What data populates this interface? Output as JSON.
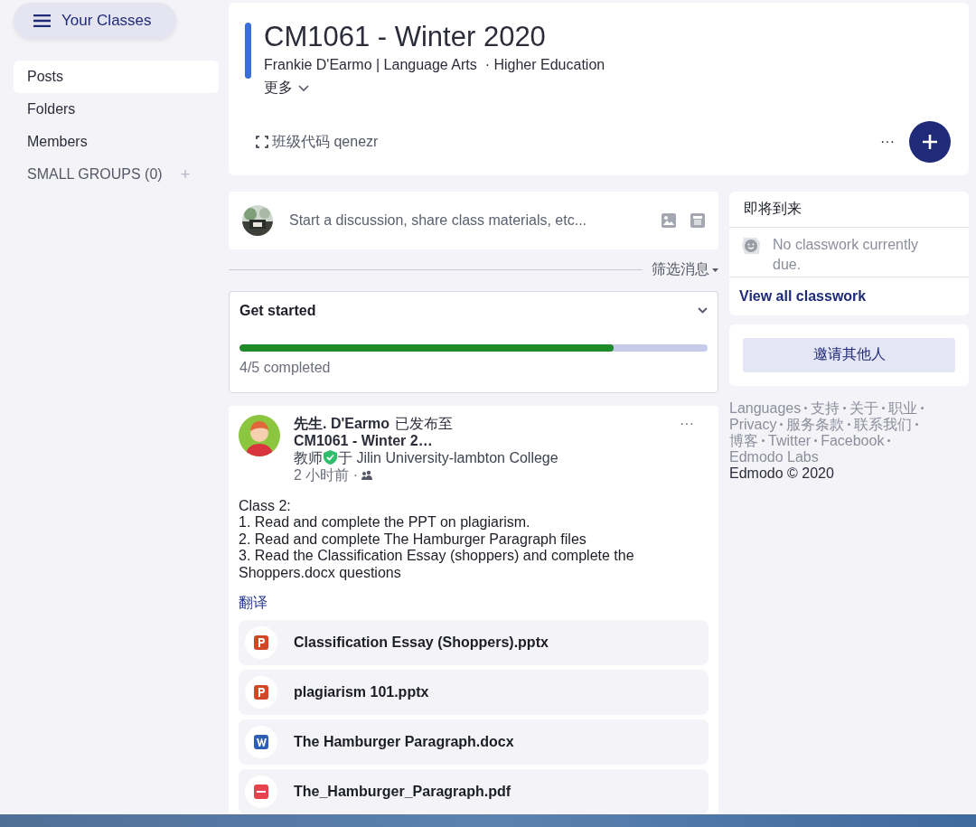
{
  "sidebar": {
    "classes_button": "Your Classes",
    "items": [
      {
        "label": "Posts",
        "selected": true
      },
      {
        "label": "Folders",
        "selected": false
      },
      {
        "label": "Members",
        "selected": false
      }
    ],
    "small_groups": "SMALL GROUPS (0)",
    "add_icon": "+"
  },
  "header": {
    "title": "CM1061 - Winter 2020",
    "subtitle": "Frankie D'Earmo | Language Arts  · Higher Education",
    "more": "更多",
    "class_code": "班级代码 qenezr",
    "ellipsis": "···"
  },
  "composer": {
    "placeholder": "Start a discussion, share class materials, etc..."
  },
  "filter": "筛选消息",
  "get_started": {
    "title": "Get started",
    "level": 0.8,
    "status": "4/5 completed"
  },
  "post": {
    "author": "先生. D'Earmo",
    "posted_to": "已发布至",
    "class": "CM1061 - Winter 2…",
    "role": "教师",
    "school": "于 Jilin University-lambton College",
    "time": "2 小时前 ·",
    "ellipsis": "···",
    "body": [
      "Class 2:",
      "1. Read and complete the PPT on plagiarism.",
      "2. Read and complete The Hamburger Paragraph files",
      "3. Read the Classification Essay (shoppers) and complete the Shoppers.docx questions"
    ],
    "translate": "翻译",
    "files": [
      {
        "kind": "pptx",
        "name": "Classification Essay (Shoppers).pptx"
      },
      {
        "kind": "pptx",
        "name": "plagiarism 101.pptx"
      },
      {
        "kind": "docx",
        "name": "The Hamburger Paragraph.docx"
      },
      {
        "kind": "pdf",
        "name": "The_Hamburger_Paragraph.pdf"
      }
    ]
  },
  "upcoming": {
    "title": "即将到来",
    "empty": "No classwork currently due.",
    "link": "View all classwork"
  },
  "invite": "邀请其他人",
  "footer": {
    "lines": [
      [
        "Languages",
        "支持",
        "关于",
        "职业"
      ],
      [
        "Privacy",
        "服务条款",
        "联系我们"
      ],
      [
        "博客",
        "Twitter",
        "Facebook"
      ],
      [
        "Edmodo Labs"
      ]
    ],
    "copyright": "Edmodo © 2020"
  }
}
